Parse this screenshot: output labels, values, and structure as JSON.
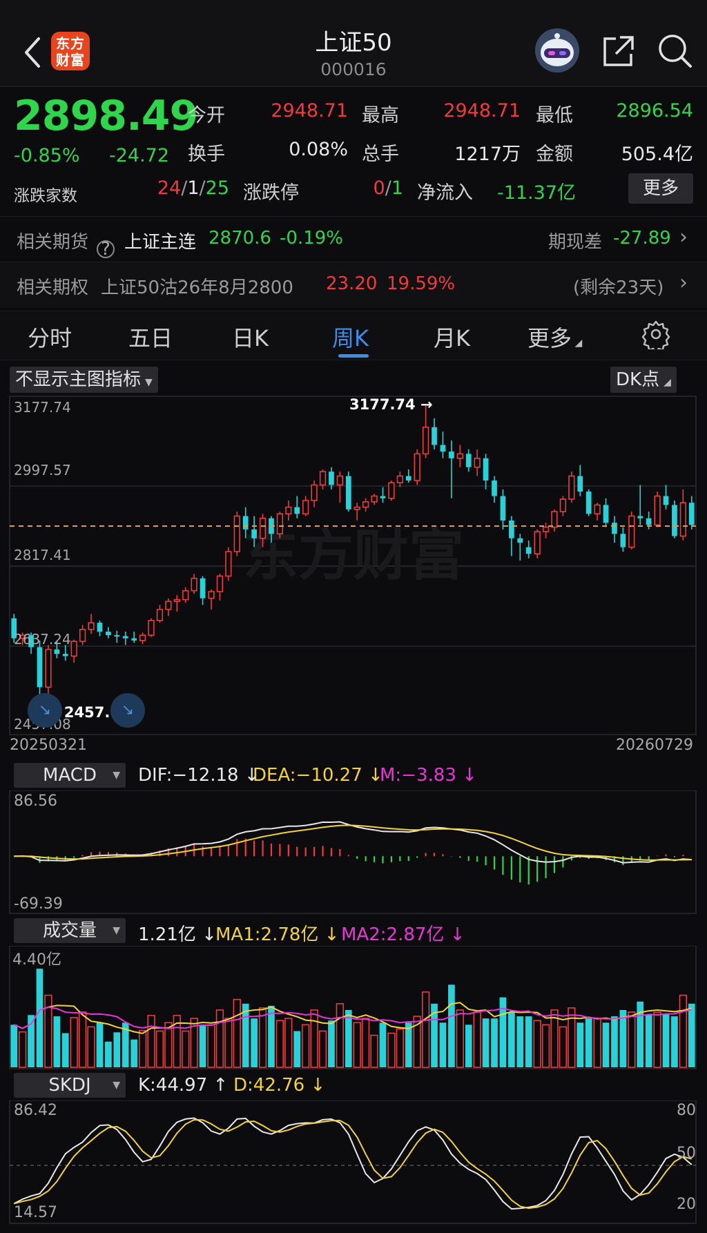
{
  "header": {
    "title": "上证50",
    "code": "000016",
    "logo_text_1": "东方",
    "logo_text_2": "财富"
  },
  "quote": {
    "price": "2898.49",
    "change_pct": "-0.85%",
    "change_amt": "-24.72",
    "open_label": "今开",
    "open": "2948.71",
    "high_label": "最高",
    "high": "2948.71",
    "low_label": "最低",
    "low": "2896.54",
    "turnover_label": "换手",
    "turnover": "0.08%",
    "volume_label": "总手",
    "volume": "1217万",
    "amount_label": "金额",
    "amount": "505.4亿",
    "breadth_label": "涨跌家数",
    "up": "24",
    "flat": "1",
    "down": "25",
    "limit_label": "涨跌停",
    "limit_up": "0",
    "limit_down": "1",
    "netflow_label": "净流入",
    "netflow": "-11.37亿",
    "more_label": "更多"
  },
  "futures": {
    "label": "相关期货",
    "name": "上证主连",
    "price": "2870.6",
    "pct": "-0.19%",
    "basis_label": "期现差",
    "basis": "-27.89"
  },
  "options": {
    "label": "相关期权",
    "name": "上证50沽26年8月2800",
    "price": "23.20",
    "pct": "19.59%",
    "remain": "(剩余23天)"
  },
  "tabs": [
    {
      "label": "分时"
    },
    {
      "label": "五日"
    },
    {
      "label": "日K"
    },
    {
      "label": "周K",
      "active": true
    },
    {
      "label": "月K"
    },
    {
      "label": "更多"
    }
  ],
  "main_chart": {
    "indicator_selector": "不显示主图指标",
    "dk_label": "DK点",
    "axis_labels": [
      "3177.74",
      "2997.57",
      "2817.41",
      "2637.24",
      "2457.08"
    ],
    "high_marker": "3177.74",
    "low_marker": "2457.08",
    "start_date": "20250321",
    "end_date": "20260729",
    "watermark": "东方财富"
  },
  "macd": {
    "selector": "MACD",
    "dif": "DIF:−12.18",
    "dea": "DEA:−10.27",
    "m": "M:−3.83",
    "max": "86.56",
    "min": "-69.39"
  },
  "volume": {
    "selector": "成交量",
    "vol": "1.21亿",
    "ma1": "MA1:2.78亿",
    "ma2": "MA2:2.87亿",
    "max": "4.40亿"
  },
  "skdj": {
    "selector": "SKDJ",
    "k": "K:44.97",
    "d": "D:42.76",
    "max": "86.42",
    "min": "14.57",
    "r80": "80",
    "r50": "50",
    "r20": "20"
  },
  "colors": {
    "up": "#f23a3a",
    "down": "#27d3d8",
    "green": "#2fd54a",
    "accent": "#3d8ee8",
    "yellow": "#f2d33a",
    "magenta": "#e735d8"
  },
  "chart_data": {
    "type": "candlestick",
    "interval": "weekly",
    "ylim": [
      2457.08,
      3177.74
    ],
    "candles": [
      [
        2700,
        2710,
        2645,
        2655
      ],
      [
        2655,
        2668,
        2640,
        2662
      ],
      [
        2662,
        2668,
        2620,
        2635
      ],
      [
        2635,
        2650,
        2457,
        2545
      ],
      [
        2545,
        2640,
        2530,
        2630
      ],
      [
        2630,
        2650,
        2610,
        2620
      ],
      [
        2620,
        2640,
        2605,
        2615
      ],
      [
        2615,
        2652,
        2600,
        2648
      ],
      [
        2648,
        2685,
        2640,
        2675
      ],
      [
        2675,
        2710,
        2665,
        2690
      ],
      [
        2690,
        2695,
        2660,
        2670
      ],
      [
        2670,
        2680,
        2655,
        2662
      ],
      [
        2662,
        2672,
        2645,
        2660
      ],
      [
        2660,
        2670,
        2640,
        2655
      ],
      [
        2655,
        2670,
        2645,
        2650
      ],
      [
        2650,
        2668,
        2642,
        2662
      ],
      [
        2662,
        2700,
        2658,
        2695
      ],
      [
        2695,
        2730,
        2690,
        2720
      ],
      [
        2720,
        2745,
        2705,
        2738
      ],
      [
        2738,
        2752,
        2715,
        2742
      ],
      [
        2742,
        2770,
        2735,
        2762
      ],
      [
        2762,
        2800,
        2755,
        2790
      ],
      [
        2790,
        2795,
        2730,
        2745
      ],
      [
        2745,
        2765,
        2720,
        2760
      ],
      [
        2760,
        2800,
        2740,
        2795
      ],
      [
        2795,
        2860,
        2785,
        2850
      ],
      [
        2850,
        2940,
        2840,
        2930
      ],
      [
        2930,
        2950,
        2880,
        2900
      ],
      [
        2900,
        2930,
        2860,
        2880
      ],
      [
        2880,
        2935,
        2860,
        2925
      ],
      [
        2925,
        2930,
        2870,
        2890
      ],
      [
        2890,
        2940,
        2880,
        2935
      ],
      [
        2935,
        2965,
        2920,
        2950
      ],
      [
        2950,
        2975,
        2925,
        2935
      ],
      [
        2935,
        2975,
        2930,
        2965
      ],
      [
        2965,
        3010,
        2950,
        3000
      ],
      [
        3000,
        3035,
        2990,
        3030
      ],
      [
        3030,
        3040,
        2990,
        3000
      ],
      [
        3000,
        3030,
        2960,
        3020
      ],
      [
        3020,
        3030,
        2940,
        2945
      ],
      [
        2945,
        2960,
        2920,
        2950
      ],
      [
        2950,
        2970,
        2940,
        2962
      ],
      [
        2962,
        2980,
        2955,
        2975
      ],
      [
        2975,
        2995,
        2960,
        2970
      ],
      [
        2970,
        3010,
        2965,
        3005
      ],
      [
        3005,
        3030,
        2995,
        3020
      ],
      [
        3020,
        3035,
        3005,
        3010
      ],
      [
        3010,
        3080,
        3000,
        3070
      ],
      [
        3070,
        3177.74,
        3060,
        3130
      ],
      [
        3130,
        3150,
        3080,
        3090
      ],
      [
        3090,
        3120,
        3060,
        3075
      ],
      [
        3075,
        3100,
        2970,
        3060
      ],
      [
        3060,
        3090,
        3040,
        3070
      ],
      [
        3070,
        3080,
        3030,
        3040
      ],
      [
        3040,
        3080,
        3020,
        3060
      ],
      [
        3060,
        3070,
        2990,
        3010
      ],
      [
        3010,
        3020,
        2960,
        2975
      ],
      [
        2975,
        2990,
        2900,
        2920
      ],
      [
        2920,
        2930,
        2840,
        2880
      ],
      [
        2880,
        2890,
        2830,
        2870
      ],
      [
        2860,
        2875,
        2835,
        2845
      ],
      [
        2845,
        2900,
        2835,
        2895
      ],
      [
        2895,
        2915,
        2880,
        2905
      ],
      [
        2905,
        2945,
        2895,
        2940
      ],
      [
        2940,
        2975,
        2930,
        2968
      ],
      [
        2968,
        3030,
        2960,
        3020
      ],
      [
        3020,
        3045,
        2975,
        2985
      ],
      [
        2985,
        2990,
        2930,
        2935
      ],
      [
        2935,
        2960,
        2920,
        2955
      ],
      [
        2955,
        2970,
        2905,
        2915
      ],
      [
        2915,
        2930,
        2870,
        2890
      ],
      [
        2890,
        2905,
        2850,
        2860
      ],
      [
        2860,
        2940,
        2855,
        2930
      ],
      [
        2930,
        3000,
        2910,
        2925
      ],
      [
        2925,
        2940,
        2900,
        2910
      ],
      [
        2910,
        2985,
        2905,
        2975
      ],
      [
        2975,
        3000,
        2945,
        2955
      ],
      [
        2955,
        2965,
        2880,
        2885
      ],
      [
        2885,
        2990,
        2875,
        2960
      ],
      [
        2960,
        2975,
        2900,
        2910
      ]
    ]
  }
}
